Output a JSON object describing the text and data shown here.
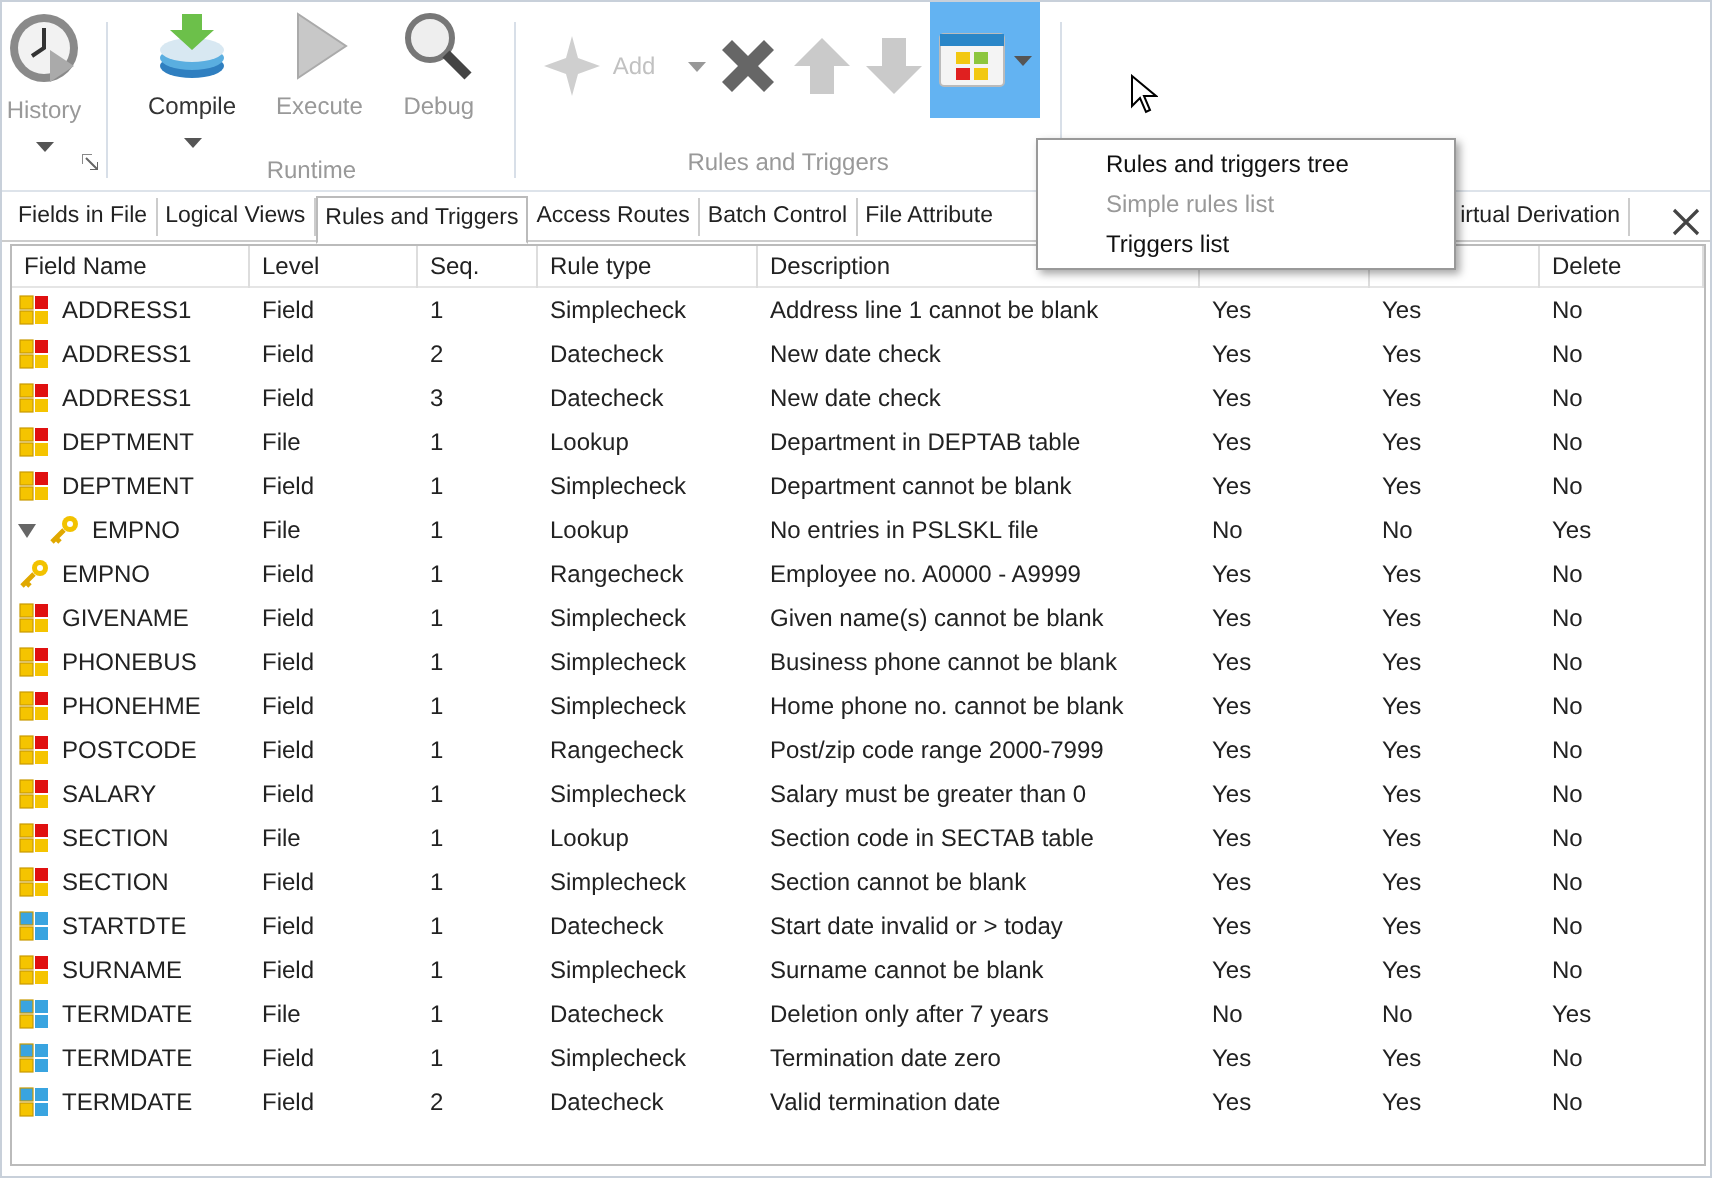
{
  "ribbon": {
    "groups": [
      {
        "buttons": [
          {
            "kind": "history",
            "label": "History",
            "disabled": true
          }
        ]
      },
      {
        "label": "Runtime",
        "buttons": [
          {
            "kind": "compile",
            "label": "Compile",
            "disabled": false
          },
          {
            "kind": "execute",
            "label": "Execute",
            "disabled": true
          },
          {
            "kind": "debug",
            "label": "Debug",
            "disabled": true
          }
        ]
      },
      {
        "label": "Rules and Triggers",
        "buttons": [
          {
            "kind": "add",
            "label": "Add",
            "disabled": true
          },
          {
            "kind": "delete",
            "disabled": false
          },
          {
            "kind": "up",
            "disabled": true
          },
          {
            "kind": "down",
            "disabled": true
          },
          {
            "kind": "view",
            "selected": true
          }
        ]
      }
    ]
  },
  "menu": {
    "items": [
      {
        "label": "Rules and triggers tree",
        "disabled": false
      },
      {
        "label": "Simple rules list",
        "disabled": true
      },
      {
        "label": "Triggers list",
        "disabled": false
      }
    ]
  },
  "tabs": [
    {
      "label": "Fields in File",
      "selected": false
    },
    {
      "label": "Logical Views",
      "selected": false
    },
    {
      "label": "Rules and Triggers",
      "selected": true
    },
    {
      "label": "Access Routes",
      "selected": false
    },
    {
      "label": "Batch Control",
      "selected": false
    },
    {
      "label": "File Attribute",
      "selected": false
    },
    {
      "label": "irtual Derivation",
      "selected": false
    }
  ],
  "table": {
    "columns": [
      "Field Name",
      "Level",
      "Seq.",
      "Rule type",
      "Description",
      null,
      null,
      "Delete"
    ],
    "rows": [
      {
        "kind": "rule",
        "expanded": false,
        "cells": [
          "ADDRESS1",
          "Field",
          "1",
          "Simplecheck",
          "Address line 1 cannot be blank",
          "Yes",
          "Yes",
          "No"
        ]
      },
      {
        "kind": "rule",
        "expanded": false,
        "cells": [
          "ADDRESS1",
          "Field",
          "2",
          "Datecheck",
          "New date check",
          "Yes",
          "Yes",
          "No"
        ]
      },
      {
        "kind": "rule",
        "expanded": false,
        "cells": [
          "ADDRESS1",
          "Field",
          "3",
          "Datecheck",
          "New date check",
          "Yes",
          "Yes",
          "No"
        ]
      },
      {
        "kind": "rule",
        "expanded": false,
        "cells": [
          "DEPTMENT",
          "File",
          "1",
          "Lookup",
          "Department in DEPTAB table",
          "Yes",
          "Yes",
          "No"
        ]
      },
      {
        "kind": "rule",
        "expanded": false,
        "cells": [
          "DEPTMENT",
          "Field",
          "1",
          "Simplecheck",
          "Department cannot be blank",
          "Yes",
          "Yes",
          "No"
        ]
      },
      {
        "kind": "key",
        "expanded": true,
        "cells": [
          "EMPNO",
          "File",
          "1",
          "Lookup",
          "No entries in PSLSKL file",
          "No",
          "No",
          "Yes"
        ]
      },
      {
        "kind": "key",
        "expanded": false,
        "cells": [
          "EMPNO",
          "Field",
          "1",
          "Rangecheck",
          "Employee no. A0000 - A9999",
          "Yes",
          "Yes",
          "No"
        ]
      },
      {
        "kind": "rule",
        "expanded": false,
        "cells": [
          "GIVENAME",
          "Field",
          "1",
          "Simplecheck",
          "Given name(s) cannot be blank",
          "Yes",
          "Yes",
          "No"
        ]
      },
      {
        "kind": "rule",
        "expanded": false,
        "cells": [
          "PHONEBUS",
          "Field",
          "1",
          "Simplecheck",
          "Business phone cannot be blank",
          "Yes",
          "Yes",
          "No"
        ]
      },
      {
        "kind": "rule",
        "expanded": false,
        "cells": [
          "PHONEHME",
          "Field",
          "1",
          "Simplecheck",
          "Home phone no. cannot be blank",
          "Yes",
          "Yes",
          "No"
        ]
      },
      {
        "kind": "rule",
        "expanded": false,
        "cells": [
          "POSTCODE",
          "Field",
          "1",
          "Rangecheck",
          "Post/zip code range 2000-7999",
          "Yes",
          "Yes",
          "No"
        ]
      },
      {
        "kind": "rule",
        "expanded": false,
        "cells": [
          "SALARY",
          "Field",
          "1",
          "Simplecheck",
          "Salary must be greater than 0",
          "Yes",
          "Yes",
          "No"
        ]
      },
      {
        "kind": "rule",
        "expanded": false,
        "cells": [
          "SECTION",
          "File",
          "1",
          "Lookup",
          "Section code in SECTAB table",
          "Yes",
          "Yes",
          "No"
        ]
      },
      {
        "kind": "rule",
        "expanded": false,
        "cells": [
          "SECTION",
          "Field",
          "1",
          "Simplecheck",
          "Section cannot be blank",
          "Yes",
          "Yes",
          "No"
        ]
      },
      {
        "kind": "date",
        "expanded": false,
        "cells": [
          "STARTDTE",
          "Field",
          "1",
          "Datecheck",
          "Start date invalid or > today",
          "Yes",
          "Yes",
          "No"
        ]
      },
      {
        "kind": "rule",
        "expanded": false,
        "cells": [
          "SURNAME",
          "Field",
          "1",
          "Simplecheck",
          "Surname cannot be blank",
          "Yes",
          "Yes",
          "No"
        ]
      },
      {
        "kind": "date",
        "expanded": false,
        "cells": [
          "TERMDATE",
          "File",
          "1",
          "Datecheck",
          "Deletion only after 7 years",
          "No",
          "No",
          "Yes"
        ]
      },
      {
        "kind": "date",
        "expanded": false,
        "cells": [
          "TERMDATE",
          "Field",
          "1",
          "Simplecheck",
          "Termination date zero",
          "Yes",
          "Yes",
          "No"
        ]
      },
      {
        "kind": "date",
        "expanded": false,
        "cells": [
          "TERMDATE",
          "Field",
          "2",
          "Datecheck",
          "Valid termination date",
          "Yes",
          "Yes",
          "No"
        ]
      }
    ]
  }
}
